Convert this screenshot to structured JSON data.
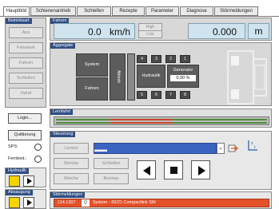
{
  "tabs": [
    "Hauptbild",
    "Schienenantrieb",
    "Schleifen",
    "Rezepte",
    "Parameter",
    "Diagnose",
    "Störmeldungen"
  ],
  "betriebsart": {
    "title": "Betriebsart",
    "buttons": [
      "Aus",
      "Fahrwerk",
      "Fahren",
      "Schleifen",
      "Hand"
    ],
    "login_label": "Login...",
    "quittierung_label": "Quittierung",
    "sps_label": "SPS:",
    "fernbed_label": "Fernbed.:"
  },
  "hydraulik": {
    "title": "Hydraulik"
  },
  "absaugung": {
    "title": "Absaugung"
  },
  "fahren": {
    "title": "Fahren",
    "speed_value": "0.0",
    "speed_unit": "km/h",
    "high_label": "High",
    "low_label": "Low",
    "position_value": "0.000",
    "position_unit": "m"
  },
  "aggregate": {
    "title": "Aggregate",
    "system_label": "System",
    "fahren_label": "Fahren",
    "abtrieb_label": "Abtrieb",
    "schleifen_label": "Schleifen",
    "hydraulik_label": "Hydraulik",
    "generator_label": "Generator",
    "generator_value": "0.00",
    "generator_unit": "%",
    "top_cells": [
      "4",
      "3",
      "2",
      "1"
    ],
    "bottom_cells": [
      "5",
      "6",
      "7",
      "8"
    ]
  },
  "lernfahrt": {
    "title": "Lernfahrt"
  },
  "steuerung": {
    "title": "Steuerung",
    "lernen_label": "Lernen",
    "strecke_label": "Strecke",
    "schleifen_label": "Schleifen",
    "weiche_label": "Weiche",
    "bremse_label": "Bremse",
    "dropdown_value": ""
  },
  "stoermeldungen": {
    "title": "Störmeldungen",
    "code": "114.1307",
    "message": "System - 60/21 Compactlink SM"
  },
  "colors": {
    "header_blue": "#2f4e86",
    "display_bg": "#cfe4ee",
    "error_red": "#e4502a",
    "track_green": "#4f8a3a",
    "track_red": "#c8442b",
    "yellow": "#f5d400"
  }
}
